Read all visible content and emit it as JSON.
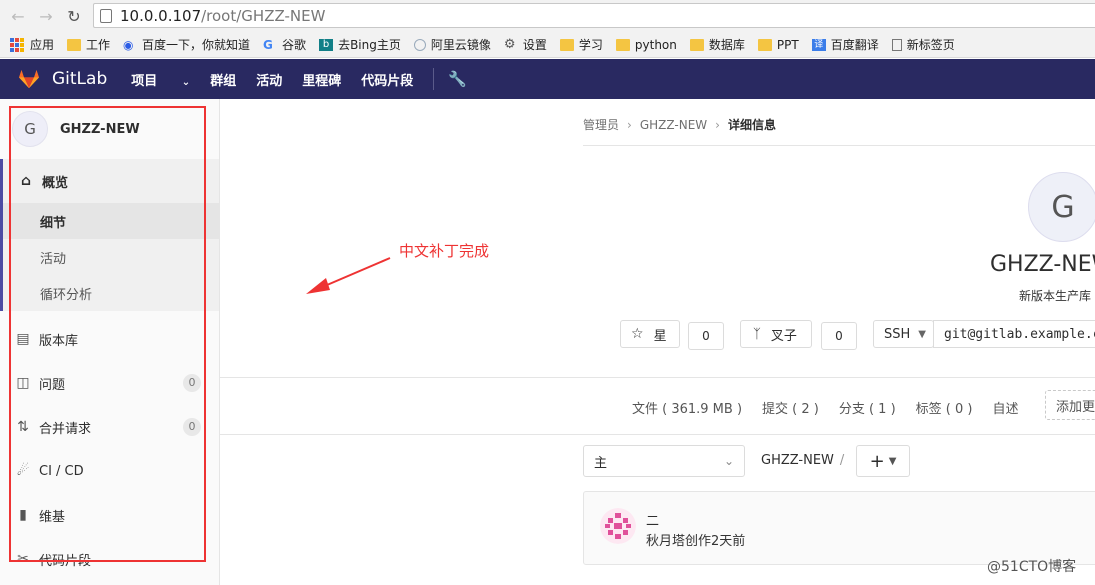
{
  "browser": {
    "url_host": "10.0.0.107",
    "url_path": "/root/GHZZ-NEW",
    "bookmarks": [
      "应用",
      "工作",
      "百度一下，你就知道",
      "谷歌",
      "去Bing主页",
      "阿里云镜像",
      "设置",
      "学习",
      "python",
      "数据库",
      "PPT",
      "百度翻译",
      "新标签页"
    ]
  },
  "header": {
    "brand": "GitLab",
    "menu": [
      "项目",
      "群组",
      "活动",
      "里程碑",
      "代码片段"
    ]
  },
  "sidebar": {
    "avatar_letter": "G",
    "project": "GHZZ-NEW",
    "overview": "概览",
    "sub": [
      "细节",
      "活动",
      "循环分析"
    ],
    "items": [
      {
        "label": "版本库"
      },
      {
        "label": "问题",
        "count": "0"
      },
      {
        "label": "合并请求",
        "count": "0"
      },
      {
        "label": "CI / CD"
      },
      {
        "label": "维基"
      },
      {
        "label": "代码片段"
      }
    ]
  },
  "annotation": "中文补丁完成",
  "breadcrumb": [
    "管理员",
    "GHZZ-NEW",
    "详细信息"
  ],
  "project": {
    "avatar_letter": "G",
    "name": "GHZZ-NEW",
    "description": "新版本生产库",
    "star_label": "星",
    "star_count": "0",
    "fork_label": "叉子",
    "fork_count": "0",
    "ssh_label": "SSH",
    "ssh_url": "git@gitlab.example.com:root/GHZZ-NEW.git"
  },
  "stats": {
    "files": "文件 ( 361.9 MB )",
    "commits": "提交 ( 2 )",
    "branches": "分支 ( 1 )",
    "tags": "标签 ( 0 )",
    "readme": "自述",
    "add_more": "添加更改日志"
  },
  "repo": {
    "branch": "主",
    "path": "GHZZ-NEW",
    "slash": "/",
    "plus": "+"
  },
  "commit": {
    "title": "二",
    "meta": "秋月塔创作2天前"
  },
  "watermark": "@51CTO博客"
}
